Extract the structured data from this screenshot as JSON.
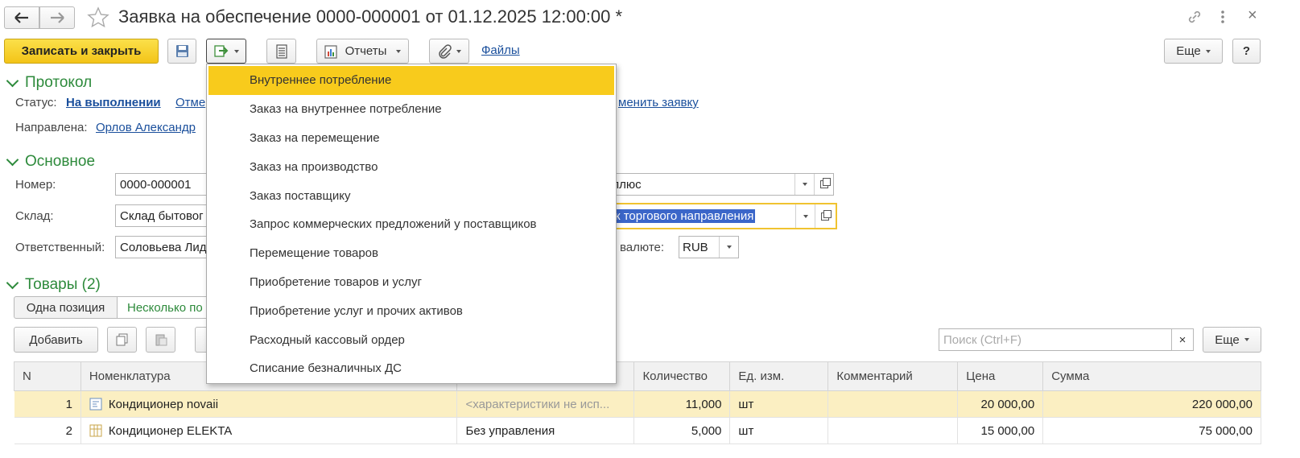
{
  "window": {
    "title": "Заявка на обеспечение 0000-000001 от 01.12.2025 12:00:00 *",
    "link_icon": "link-icon",
    "more_icon": "more-vert-icon",
    "close_label": "×"
  },
  "toolbar": {
    "save_close": "Записать и закрыть",
    "reports": "Отчеты",
    "files": "Файлы",
    "more": "Еще",
    "help": "?"
  },
  "protocol": {
    "title": "Протокол",
    "status_label": "Статус:",
    "status_value": "На выполнении",
    "status_link2": "Отме",
    "status_link3": "менить заявку",
    "sent_label": "Направлена:",
    "sent_value": "Орлов Александр"
  },
  "main": {
    "title": "Основное",
    "number_label": "Номер:",
    "number_value": "0000-000001",
    "org_value_tail": "плюс",
    "warehouse_label": "Склад:",
    "warehouse_value": "Склад бытовог",
    "dept_value_tail": "к торгового направления",
    "responsible_label": "Ответственный:",
    "responsible_value": "Соловьева Лид",
    "currency_label": "валюте:",
    "currency_value": "RUB"
  },
  "goods": {
    "title": "Товары (2)",
    "tab_one": "Одна позиция",
    "tab_several": "Несколько по",
    "add": "Добавить",
    "search_placeholder": "Поиск (Ctrl+F)",
    "search_clear": "×",
    "more": "Еще",
    "columns": [
      "N",
      "Номенклатура",
      "",
      "Количество",
      "Ед. изм.",
      "Комментарий",
      "Цена",
      "Сумма"
    ],
    "rows": [
      {
        "n": "1",
        "name": "Кондиционер novaii",
        "char": "<характеристики не исп...",
        "qty": "11,000",
        "unit": "шт",
        "comment": "",
        "price": "20 000,00",
        "sum": "220 000,00"
      },
      {
        "n": "2",
        "name": "Кондиционер ELEKTA",
        "char": "Без управления",
        "qty": "5,000",
        "unit": "шт",
        "comment": "",
        "price": "15 000,00",
        "sum": "75 000,00"
      }
    ]
  },
  "create_menu": {
    "items": [
      "Внутреннее потребление",
      "Заказ на внутреннее потребление",
      "Заказ на перемещение",
      "Заказ на производство",
      "Заказ поставщику",
      "Запрос коммерческих предложений у поставщиков",
      "Перемещение товаров",
      "Приобретение товаров и услуг",
      "Приобретение услуг и прочих активов",
      "Расходный кассовый ордер",
      "Списание безналичных ДС"
    ],
    "active_index": 0
  },
  "colors": {
    "accent_yellow": "#f8cb1c",
    "section_green": "#2d8a3b",
    "link_blue": "#1a4f9c",
    "selection_row": "#fbefc2"
  }
}
